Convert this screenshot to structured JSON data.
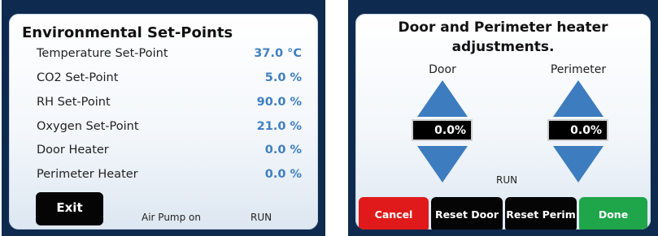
{
  "left": {
    "title": "Environmental Set-Points",
    "rows": [
      {
        "label": "Temperature Set-Point",
        "value": "37.0 °C"
      },
      {
        "label": "CO2 Set-Point",
        "value": "5.0 %"
      },
      {
        "label": "RH Set-Point",
        "value": "90.0 %"
      },
      {
        "label": "Oxygen Set-Point",
        "value": "21.0 %"
      },
      {
        "label": "Door Heater",
        "value": "0.0 %"
      },
      {
        "label": "Perimeter Heater",
        "value": "0.0 %"
      }
    ],
    "exit_label": "Exit",
    "pump_status": "Air Pump on",
    "run_status": "RUN"
  },
  "right": {
    "title_line1": "Door and Perimeter heater",
    "title_line2": "adjustments.",
    "door_label": "Door",
    "perimeter_label": "Perimeter",
    "door_value": "0.0%",
    "perimeter_value": "0.0%",
    "run_status": "RUN",
    "buttons": {
      "cancel": "Cancel",
      "reset_door": "Reset Door",
      "reset_perim": "Reset Perim",
      "done": "Done"
    }
  },
  "colors": {
    "frame": "#0e2a4e",
    "value_text": "#3f7fc1",
    "arrow": "#3c7cbf",
    "cancel": "#e01a1a",
    "done": "#1fa64a",
    "dark_button": "#050505"
  },
  "icons": [
    "arrow-up-icon",
    "arrow-down-icon"
  ]
}
